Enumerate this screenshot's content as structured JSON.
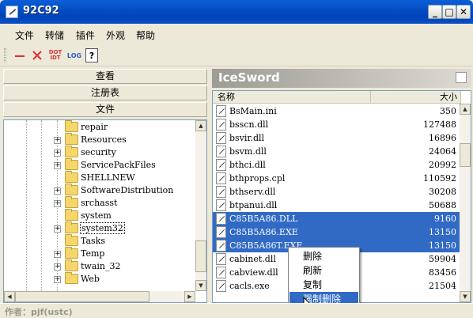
{
  "window": {
    "title": "92C92",
    "min_label": "_",
    "max_label": "□",
    "close_label": "✕"
  },
  "menu": [
    {
      "label": "文件"
    },
    {
      "label": "转储"
    },
    {
      "label": "插件"
    },
    {
      "label": "外观"
    },
    {
      "label": "帮助"
    }
  ],
  "toolbar": {
    "dot_top": "DOT",
    "dot_bottom": "IDT",
    "log_label": "LOG",
    "help_label": "?"
  },
  "left": {
    "nav": [
      {
        "label": "查看"
      },
      {
        "label": "注册表"
      },
      {
        "label": "文件"
      }
    ],
    "tree": [
      {
        "label": "repair",
        "expander": ""
      },
      {
        "label": "Resources",
        "expander": "+"
      },
      {
        "label": "security",
        "expander": "+"
      },
      {
        "label": "ServicePackFiles",
        "expander": "+"
      },
      {
        "label": "SHELLNEW",
        "expander": ""
      },
      {
        "label": "SoftwareDistribution",
        "expander": "+"
      },
      {
        "label": "srchasst",
        "expander": "+"
      },
      {
        "label": "system",
        "expander": ""
      },
      {
        "label": "system32",
        "expander": "+",
        "selected": true
      },
      {
        "label": "Tasks",
        "expander": ""
      },
      {
        "label": "Temp",
        "expander": "+"
      },
      {
        "label": "twain_32",
        "expander": "+"
      },
      {
        "label": "Web",
        "expander": "+"
      }
    ]
  },
  "right": {
    "brand": "IceSword",
    "columns": {
      "name": "名称",
      "size": "大小"
    },
    "files": [
      {
        "name": "BsMain.ini",
        "size": "350",
        "selected": false
      },
      {
        "name": "bsscn.dll",
        "size": "127488",
        "selected": false
      },
      {
        "name": "bsvir.dll",
        "size": "16896",
        "selected": false
      },
      {
        "name": "bsvm.dll",
        "size": "24064",
        "selected": false
      },
      {
        "name": "bthci.dll",
        "size": "20992",
        "selected": false
      },
      {
        "name": "bthprops.cpl",
        "size": "110592",
        "selected": false
      },
      {
        "name": "bthserv.dll",
        "size": "30208",
        "selected": false
      },
      {
        "name": "btpanui.dll",
        "size": "50688",
        "selected": false
      },
      {
        "name": "C85B5A86.DLL",
        "size": "9160",
        "selected": true
      },
      {
        "name": "C85B5A86.EXE",
        "size": "13150",
        "selected": true
      },
      {
        "name": "C85B5A86T.EXE",
        "size": "13150",
        "selected": true
      },
      {
        "name": "cabinet.dll",
        "size": "59904",
        "selected": false
      },
      {
        "name": "cabview.dll",
        "size": "83456",
        "selected": false
      },
      {
        "name": "cacls.exe",
        "size": "21504",
        "selected": false
      }
    ]
  },
  "context_menu": {
    "items": [
      {
        "label": "删除",
        "highlighted": false
      },
      {
        "label": "刷新",
        "highlighted": false
      },
      {
        "label": "复制",
        "highlighted": false
      },
      {
        "label": "强制删除",
        "highlighted": true
      }
    ]
  },
  "status": "作者：pjf(ustc)",
  "colors": {
    "title_blue": "#0a5fd8",
    "selection": "#316ac5",
    "folder": "#f5d66b",
    "toolbar_red": "#e03030"
  }
}
